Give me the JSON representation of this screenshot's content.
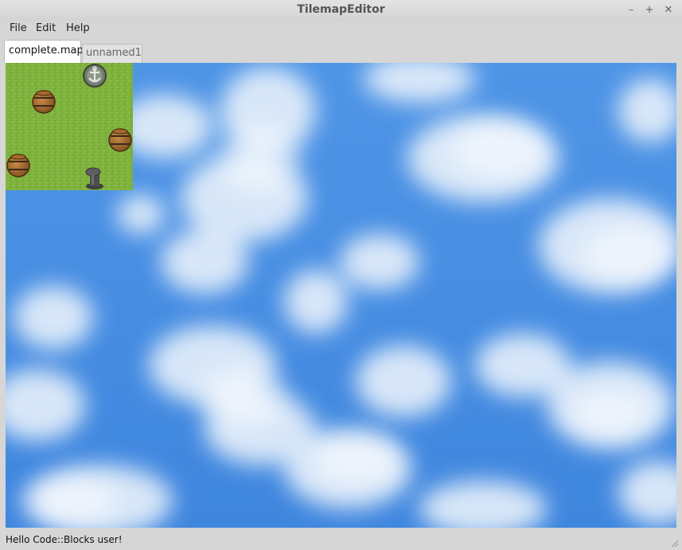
{
  "window": {
    "title": "TilemapEditor"
  },
  "window_controls": {
    "minimize": "–",
    "maximize": "+",
    "close": "✕"
  },
  "menu": {
    "items": [
      "File",
      "Edit",
      "Help"
    ]
  },
  "tabs": [
    {
      "label": "complete.map",
      "active": true
    },
    {
      "label": "unnamed1",
      "active": false
    }
  ],
  "canvas": {
    "background": "sky-clouds",
    "sky_color": "#4a8fe0",
    "tilemap": {
      "grass_color": "#7fb23e",
      "objects": [
        "barrel",
        "barrel",
        "barrel",
        "anchor-well",
        "bollard"
      ]
    }
  },
  "status": {
    "text": "Hello Code::Blocks user!"
  }
}
